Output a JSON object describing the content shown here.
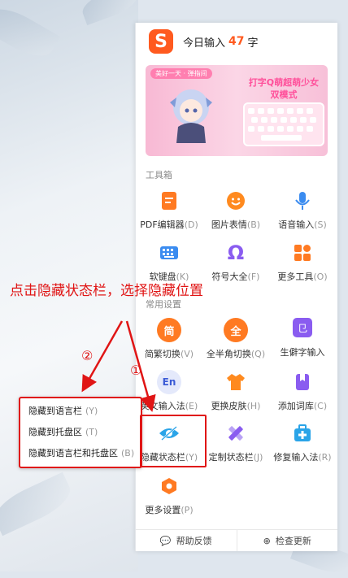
{
  "header": {
    "title_prefix": "今日输入",
    "count": "47",
    "unit": "字"
  },
  "banner": {
    "tag": "美好一天 · 弹指间",
    "title": "打字Q萌超萌少女 双模式"
  },
  "sections": {
    "toolbox": "工具箱",
    "common": "常用设置"
  },
  "tools": [
    {
      "label": "PDF编辑器",
      "key": "(D)",
      "icon": "pdf-icon",
      "color": "#ff7a22"
    },
    {
      "label": "图片表情",
      "key": "(B)",
      "icon": "emoji-icon",
      "color": "#ff8a1f"
    },
    {
      "label": "语音输入",
      "key": "(S)",
      "icon": "microphone-icon",
      "color": "#3b8cf0"
    },
    {
      "label": "软键盘",
      "key": "(K)",
      "icon": "keyboard-icon",
      "color": "#3b8cf0"
    },
    {
      "label": "符号大全",
      "key": "(F)",
      "icon": "omega-icon",
      "color": "#8a5cf0"
    },
    {
      "label": "更多工具",
      "key": "(O)",
      "icon": "grid-icon",
      "color": "#ff7a22"
    }
  ],
  "settings": [
    {
      "label": "简繁切换",
      "key": "(V)",
      "icon": "simplified-icon",
      "color": "#ff7a22",
      "glyph": "简"
    },
    {
      "label": "全半角切换",
      "key": "(Q)",
      "icon": "fullwidth-icon",
      "color": "#ff7a22",
      "glyph": "全"
    },
    {
      "label": "生僻字输入",
      "key": "",
      "icon": "rare-char-icon",
      "color": "#8a5cf0",
      "glyph": "㔾"
    },
    {
      "label": "英文输入法",
      "key": "(E)",
      "icon": "english-icon",
      "color": "#3b5bd6",
      "glyph": "En"
    },
    {
      "label": "更换皮肤",
      "key": "(H)",
      "icon": "shirt-icon",
      "color": "#ff8a1f",
      "glyph": ""
    },
    {
      "label": "添加词库",
      "key": "(C)",
      "icon": "bookmark-icon",
      "color": "#8a5cf0",
      "glyph": ""
    },
    {
      "label": "隐藏状态栏",
      "key": "(Y)",
      "icon": "eye-hidden-icon",
      "color": "#2aa4e8",
      "glyph": ""
    },
    {
      "label": "定制状态栏",
      "key": "(J)",
      "icon": "pencil-ruler-icon",
      "color": "#8a5cf0",
      "glyph": ""
    },
    {
      "label": "修复输入法",
      "key": "(R)",
      "icon": "medkit-icon",
      "color": "#2aa4e8",
      "glyph": ""
    },
    {
      "label": "更多设置",
      "key": "(P)",
      "icon": "settings-icon",
      "color": "#ff7a22",
      "glyph": ""
    }
  ],
  "footer": {
    "feedback": "帮助反馈",
    "update": "检查更新"
  },
  "popup": [
    {
      "label": "隐藏到语言栏",
      "key": "(Y)"
    },
    {
      "label": "隐藏到托盘区",
      "key": "(T)"
    },
    {
      "label": "隐藏到语言栏和托盘区",
      "key": "(B)"
    }
  ],
  "annotation": {
    "text": "点击隐藏状态栏，选择隐藏位置",
    "step1": "①",
    "step2": "②",
    "color": "#e01515"
  }
}
